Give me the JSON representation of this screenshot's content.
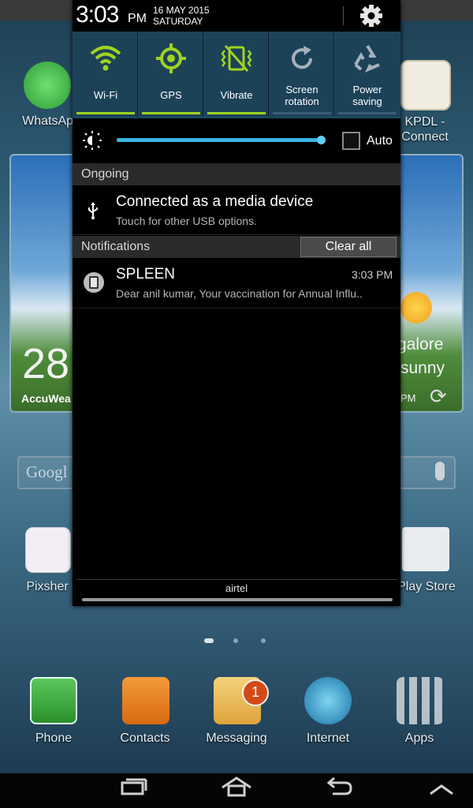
{
  "status_bar": {
    "time": "3:03",
    "ampm": "PM",
    "date": "16 MAY 2015",
    "day": "SATURDAY"
  },
  "quick_toggles": [
    {
      "label": "Wi-Fi",
      "icon": "wifi-icon",
      "active": true
    },
    {
      "label": "GPS",
      "icon": "gps-icon",
      "active": true
    },
    {
      "label": "Vibrate",
      "icon": "vibrate-icon",
      "active": true
    },
    {
      "label_line1": "Screen",
      "label_line2": "rotation",
      "icon": "screen-rotation-icon",
      "active": false
    },
    {
      "label_line1": "Power",
      "label_line2": "saving",
      "icon": "power-saving-icon",
      "active": false
    }
  ],
  "brightness": {
    "level": 0.99,
    "auto_label": "Auto",
    "auto_checked": false
  },
  "ongoing": {
    "header": "Ongoing",
    "title": "Connected as a media device",
    "subtitle": "Touch for other USB options."
  },
  "notifications": {
    "header": "Notifications",
    "clear_all": "Clear all",
    "items": [
      {
        "app": "SPLEEN",
        "time": "3:03 PM",
        "message": "Dear anil kumar, Your vaccination for Annual Influ.."
      }
    ]
  },
  "carrier": "airtel",
  "home": {
    "left_apps": [
      {
        "label": "WhatsApp"
      },
      {
        "label": "Pixsher"
      }
    ],
    "right_apps": [
      {
        "label": "KPDL - Connect"
      },
      {
        "label": "Play Store"
      }
    ],
    "weather": {
      "temp": "28",
      "brand": "AccuWea",
      "city": "galore",
      "condition": "sunny",
      "time_suffix": "PM"
    },
    "search_placeholder": "Googl",
    "dock": [
      {
        "label": "Phone"
      },
      {
        "label": "Contacts"
      },
      {
        "label": "Messaging",
        "badge": "1"
      },
      {
        "label": "Internet"
      },
      {
        "label": "Apps"
      }
    ]
  },
  "colors": {
    "accent": "#9fd321",
    "toggle_bg": "#1c4258",
    "slider": "#39b3de",
    "badge": "#d34a16"
  }
}
